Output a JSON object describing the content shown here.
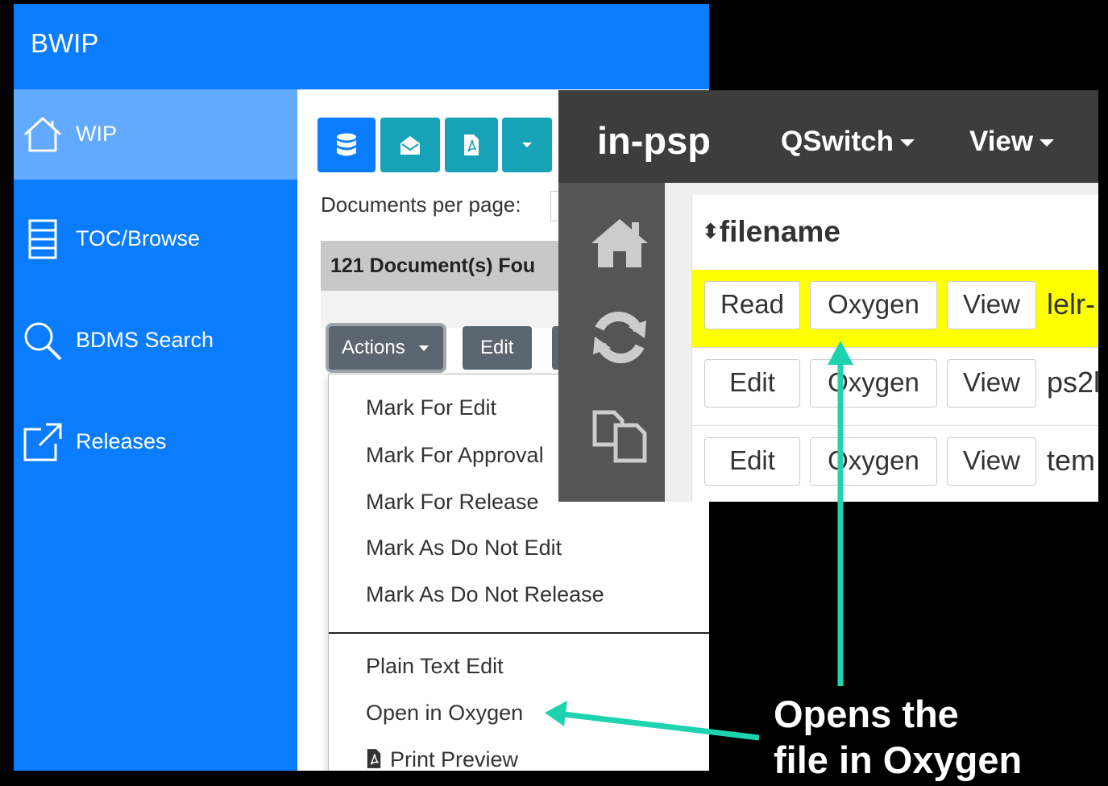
{
  "bwip": {
    "title": "BWIP",
    "sidebar": [
      {
        "label": "WIP",
        "icon": "home-icon",
        "active": true
      },
      {
        "label": "TOC/Browse",
        "icon": "list-icon",
        "active": false
      },
      {
        "label": "BDMS Search",
        "icon": "search-icon",
        "active": false
      },
      {
        "label": "Releases",
        "icon": "external-link-icon",
        "active": false
      }
    ],
    "toolbar": {
      "icons": [
        "database-icon",
        "envelope-open-icon",
        "pdf-file-icon",
        "caret-down-icon"
      ]
    },
    "documents_per_page_label": "Documents per page:",
    "found_text": "121 Document(s) Fou",
    "actions_label": "Actions",
    "edit_label": "Edit",
    "actions_menu": {
      "group1": [
        "Mark For Edit",
        "Mark For Approval",
        "Mark For Release",
        "Mark As Do Not Edit",
        "Mark As Do Not Release"
      ],
      "group2": [
        "Plain Text Edit",
        "Open in Oxygen"
      ],
      "print_preview": "Print Preview"
    },
    "colors": {
      "primary": "#0a7cff",
      "active_item": "#62aaff",
      "teal": "#17a2b8",
      "gray_button": "#5c6670"
    }
  },
  "psp": {
    "brand": "in-psp",
    "menus": [
      "QSwitch",
      "View"
    ],
    "side_icons": [
      "home-icon",
      "sync-icon",
      "copy-icon"
    ],
    "table": {
      "header": "filename",
      "rows": [
        {
          "buttons": [
            "Read",
            "Oxygen",
            "View"
          ],
          "filename": "lelr-",
          "highlight": true
        },
        {
          "buttons": [
            "Edit",
            "Oxygen",
            "View"
          ],
          "filename": "ps2l",
          "highlight": false
        },
        {
          "buttons": [
            "Edit",
            "Oxygen",
            "View"
          ],
          "filename": "tem",
          "highlight": false
        }
      ]
    },
    "colors": {
      "navbar": "#3d3d3d",
      "highlight": "#ffff00"
    }
  },
  "callout": {
    "line1": "Opens the",
    "line2": "file in Oxygen",
    "arrow_color": "#1fd3b0"
  }
}
